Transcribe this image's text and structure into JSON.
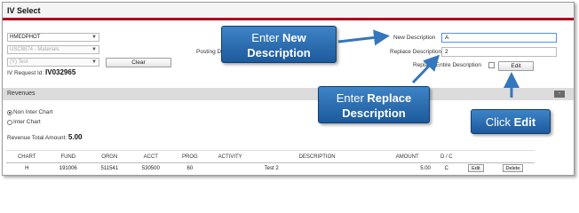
{
  "window": {
    "title": "IV Select"
  },
  "left_form": {
    "select1": "HMEDPHOT",
    "select2": "USC8874 - Materials",
    "select3": "(Y) Test",
    "clear_label": "Clear",
    "iv_request_label": "IV Request Id:",
    "iv_request_value": "IV032965"
  },
  "posting_label": "Posting D",
  "right_form": {
    "new_desc_label": "New Description",
    "new_desc_value": "A",
    "replace_desc_label": "Replace Description",
    "replace_desc_value": "2",
    "replace_entire_label": "Replace Entire Description",
    "edit_label": "Edit"
  },
  "revenues": {
    "section_label": "Revenues",
    "collapse_label": "-",
    "radio_non_inter": "Non Inter Chart",
    "radio_inter": "Inter Chart",
    "total_label": "Revenue Total Amount:",
    "total_value": "5.00"
  },
  "table": {
    "headers": [
      "CHART",
      "FUND",
      "ORGN",
      "ACCT",
      "PROG",
      "ACTIVITY",
      "DESCRIPTION",
      "AMOUNT",
      "D / C"
    ],
    "rows": [
      {
        "chart": "H",
        "fund": "191006",
        "orgn": "511541",
        "acct": "530500",
        "prog": "60",
        "activity": "",
        "description": "Test 2",
        "amount": "5.00",
        "dc": "C",
        "edit": "Edit",
        "delete": "Delete"
      }
    ]
  },
  "callouts": {
    "new_desc_pre": "Enter ",
    "new_desc_bold": "New",
    "new_desc_line2": "Description",
    "replace_pre": "Enter ",
    "replace_bold": "Replace",
    "replace_line2": "Description",
    "click_pre": "Click ",
    "click_bold": "Edit"
  },
  "colors": {
    "header_accent": "#b0001e",
    "callout_blue": "#2a6db5"
  }
}
